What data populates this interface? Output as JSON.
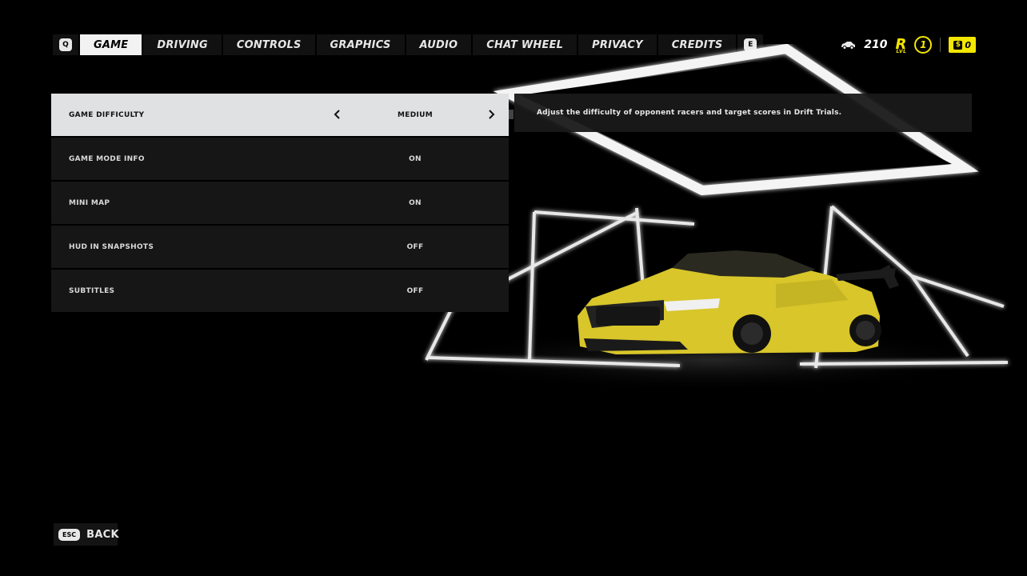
{
  "tabs": {
    "prev_key": "Q",
    "next_key": "E",
    "items": [
      {
        "label": "GAME",
        "active": true
      },
      {
        "label": "DRIVING",
        "active": false
      },
      {
        "label": "CONTROLS",
        "active": false
      },
      {
        "label": "GRAPHICS",
        "active": false
      },
      {
        "label": "AUDIO",
        "active": false
      },
      {
        "label": "CHAT WHEEL",
        "active": false
      },
      {
        "label": "PRIVACY",
        "active": false
      },
      {
        "label": "CREDITS",
        "active": false
      }
    ]
  },
  "status": {
    "car_icon": "car-icon",
    "car_count": "210",
    "rep_letter": "R",
    "rep_sub": "LVL",
    "rep_level": "1",
    "cash": "0",
    "accent_color": "#f3e600"
  },
  "settings": [
    {
      "label": "GAME DIFFICULTY",
      "value": "MEDIUM",
      "selected": true
    },
    {
      "label": "GAME MODE INFO",
      "value": "ON",
      "selected": false
    },
    {
      "label": "MINI MAP",
      "value": "ON",
      "selected": false
    },
    {
      "label": "HUD IN SNAPSHOTS",
      "value": "OFF",
      "selected": false
    },
    {
      "label": "SUBTITLES",
      "value": "OFF",
      "selected": false
    }
  ],
  "description": "Adjust the difficulty of opponent racers and target scores in Drift Trials.",
  "back": {
    "key": "ESC",
    "label": "BACK"
  }
}
